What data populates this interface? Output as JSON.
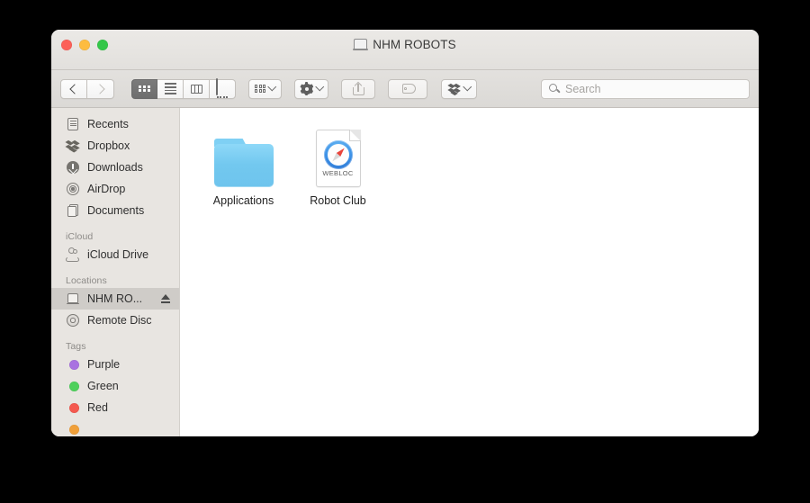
{
  "window": {
    "title": "NHM ROBOTS",
    "title_icon": "disk-icon",
    "controls": {
      "close": "close-button",
      "minimize": "minimize-button",
      "maximize": "maximize-button"
    }
  },
  "toolbar": {
    "back": "back-button",
    "forward": "forward-button",
    "view_modes": [
      {
        "name": "icon-view",
        "active": true
      },
      {
        "name": "list-view",
        "active": false
      },
      {
        "name": "column-view",
        "active": false
      },
      {
        "name": "gallery-view",
        "active": false
      }
    ],
    "arrange": "arrange-button",
    "action": "action-gear-button",
    "share": "share-button",
    "tag": "tag-button",
    "dropbox": "dropbox-button",
    "search": {
      "placeholder": "Search",
      "value": ""
    }
  },
  "sidebar": {
    "favorites": [
      {
        "label": "Recents",
        "icon": "recents-icon"
      },
      {
        "label": "Dropbox",
        "icon": "dropbox-icon"
      },
      {
        "label": "Downloads",
        "icon": "downloads-icon"
      },
      {
        "label": "AirDrop",
        "icon": "airdrop-icon"
      },
      {
        "label": "Documents",
        "icon": "documents-icon"
      }
    ],
    "icloud_header": "iCloud",
    "icloud": [
      {
        "label": "iCloud Drive",
        "icon": "icloud-icon"
      }
    ],
    "locations_header": "Locations",
    "locations": [
      {
        "label": "NHM RO...",
        "icon": "drive-icon",
        "selected": true,
        "eject": true
      },
      {
        "label": "Remote Disc",
        "icon": "disc-icon",
        "selected": false,
        "eject": false
      }
    ],
    "tags_header": "Tags",
    "tags": [
      {
        "label": "Purple",
        "color": "#a972e0"
      },
      {
        "label": "Green",
        "color": "#4ed05c"
      },
      {
        "label": "Red",
        "color": "#f4594f"
      },
      {
        "label": "",
        "color": "#f0a03a"
      }
    ]
  },
  "content": {
    "files": [
      {
        "label": "Applications",
        "kind": "folder"
      },
      {
        "label": "Robot Club",
        "kind": "webloc",
        "kind_label": "WEBLOC"
      }
    ]
  },
  "colors": {
    "sidebar_bg": "#e8e5e1",
    "content_bg": "#ffffff",
    "selection": "#cfccc8",
    "folder_blue": "#72c8ef",
    "desktop": "#000000"
  }
}
